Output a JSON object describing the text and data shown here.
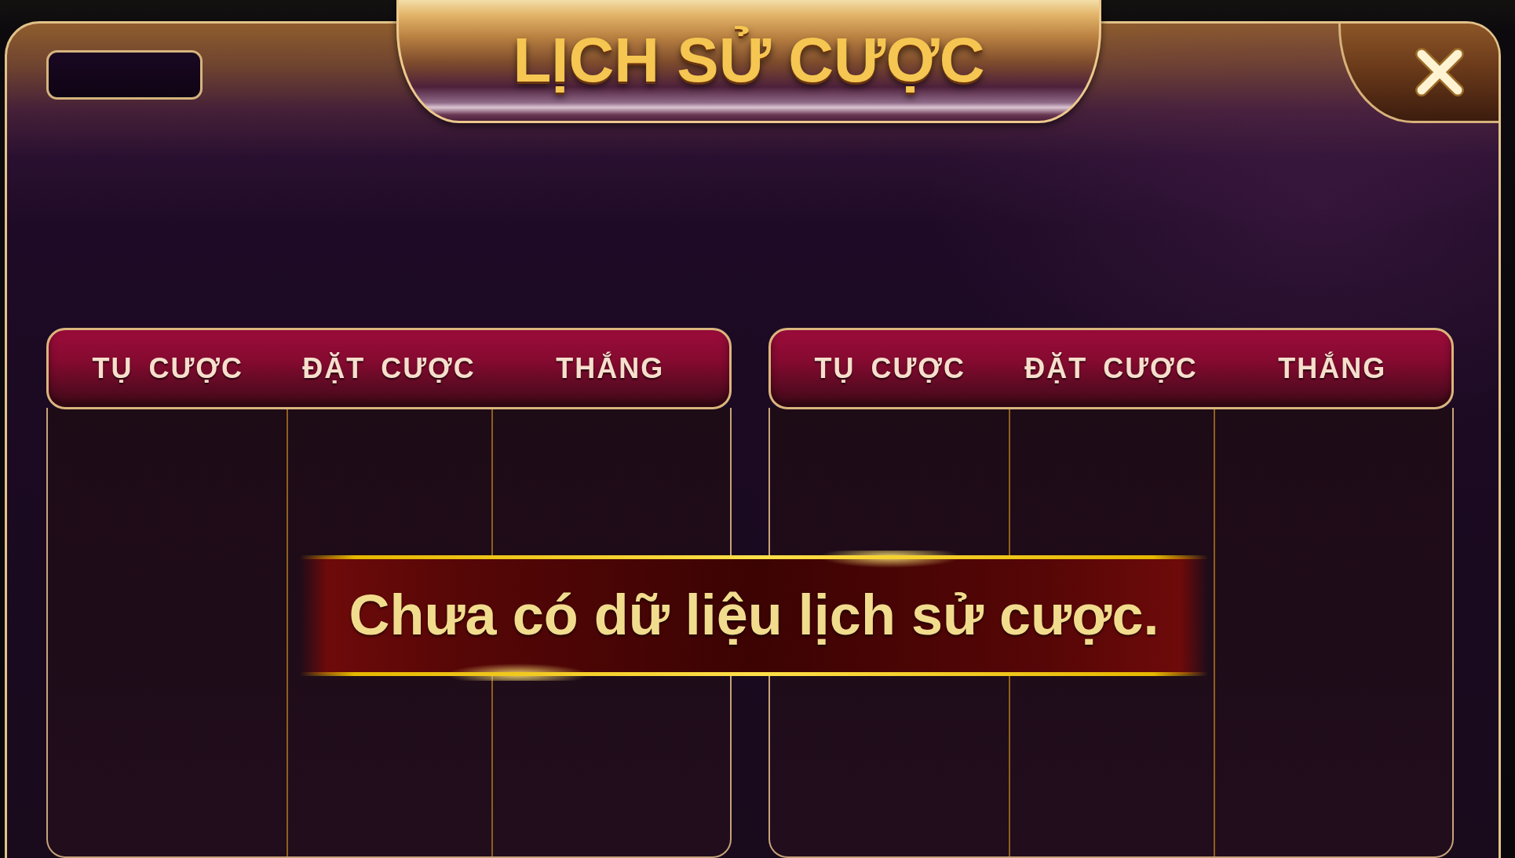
{
  "dialog": {
    "title": "LỊCH SỬ CƯỢC"
  },
  "tables": [
    {
      "columns": [
        "TỤ CƯỢC",
        "ĐẶT CƯỢC",
        "THẮNG"
      ]
    },
    {
      "columns": [
        "TỤ CƯỢC",
        "ĐẶT CƯỢC",
        "THẮNG"
      ]
    }
  ],
  "empty_message": "Chưa có dữ liệu lịch sử cược."
}
